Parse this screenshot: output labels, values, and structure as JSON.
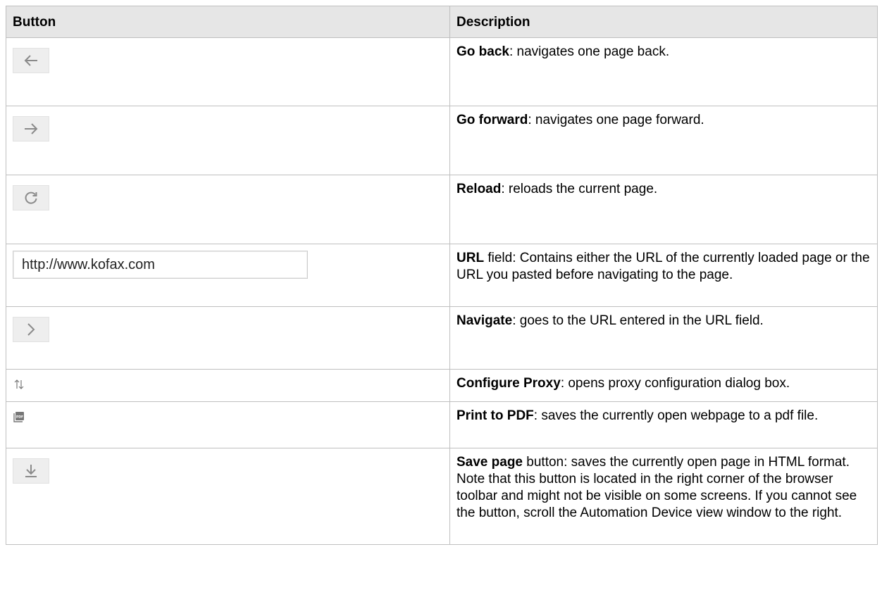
{
  "header": {
    "col1": "Button",
    "col2": "Description"
  },
  "rows": [
    {
      "icon": "arrow-left-icon",
      "title": "Go back",
      "rest": ": navigates one page back."
    },
    {
      "icon": "arrow-right-icon",
      "title": "Go forward",
      "rest": ": navigates one page forward."
    },
    {
      "icon": "reload-icon",
      "title": "Reload",
      "rest": ": reloads the current page."
    },
    {
      "icon": "url-field",
      "url_value": "http://www.kofax.com",
      "title": "URL",
      "rest": " field: Contains either the URL of the currently loaded page or the URL you pasted before navigating to the page."
    },
    {
      "icon": "chevron-right-icon",
      "title": "Navigate",
      "rest": ": goes to the URL entered in the URL field."
    },
    {
      "icon": "proxy-arrows-icon",
      "title": "Configure Proxy",
      "rest": ": opens proxy configuration dialog box."
    },
    {
      "icon": "pdf-icon",
      "icon_text": "PDF",
      "title": "Print to PDF",
      "rest": ": saves the currently open webpage to a pdf file."
    },
    {
      "icon": "download-icon",
      "title": "Save page",
      "rest": " button: saves the currently open page in HTML format. Note that this button is located in the right corner of the browser toolbar and might not be visible on some screens. If you cannot see the button, scroll the Automation Device view window to the right."
    }
  ],
  "colors": {
    "header_bg": "#e6e6e6",
    "border": "#bfbfbf",
    "icon_bg": "#eeeeee",
    "icon_glyph": "#8a8a8a"
  }
}
